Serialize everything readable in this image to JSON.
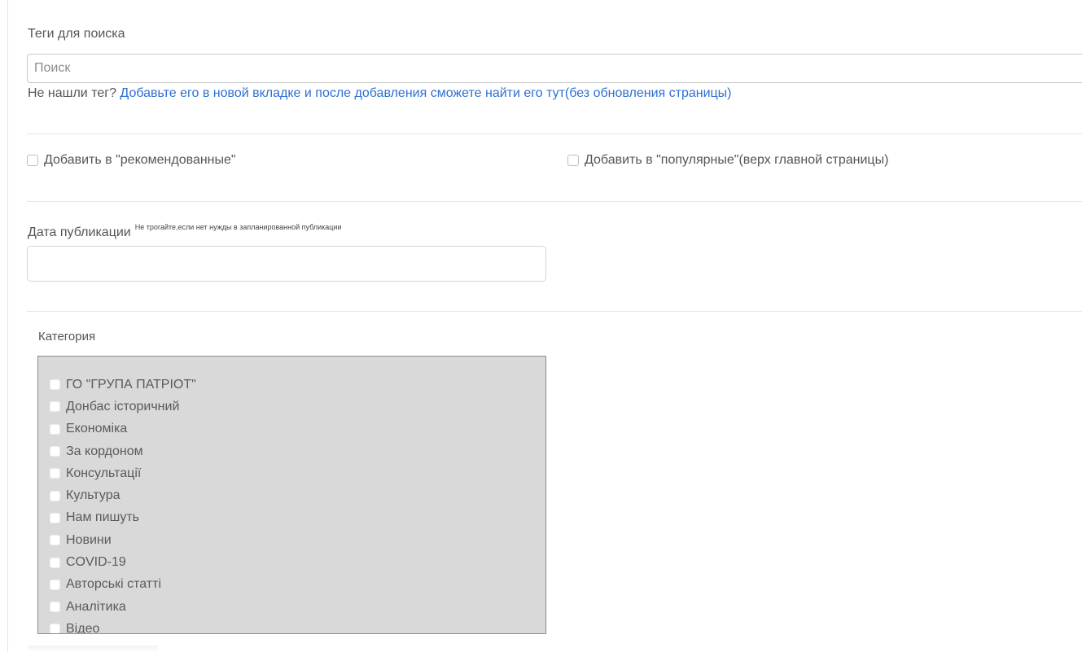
{
  "tags": {
    "label": "Теги для поиска",
    "search_placeholder": "Поиск",
    "search_value": "",
    "hint_prefix": "Не нашли тег? ",
    "hint_link": "Добавьте его в новой вкладке и после добавления сможете найти его тут(без обновления страницы)"
  },
  "options": {
    "recommended_label": "Добавить в \"рекомендованные\"",
    "recommended_checked": false,
    "popular_label": "Добавить в \"популярные\"(верх главной страницы)",
    "popular_checked": false
  },
  "publication": {
    "label": "Дата публикации",
    "note": "Не трогайте,если нет нужды в запланированной публикации",
    "date_value": ""
  },
  "category": {
    "label": "Категория",
    "items": [
      "ГО \"ГРУПА ПАТРІОТ\"",
      "Донбас історичний",
      "Економіка",
      "За кордоном",
      "Консультації",
      "Культура",
      "Нам пишуть",
      "Новини",
      "COVID-19",
      "Авторські статті",
      "Аналітика",
      "Відео"
    ]
  },
  "colors": {
    "link": "#2e6fd3",
    "category_bg": "#d9d9d9",
    "text": "#555555"
  }
}
